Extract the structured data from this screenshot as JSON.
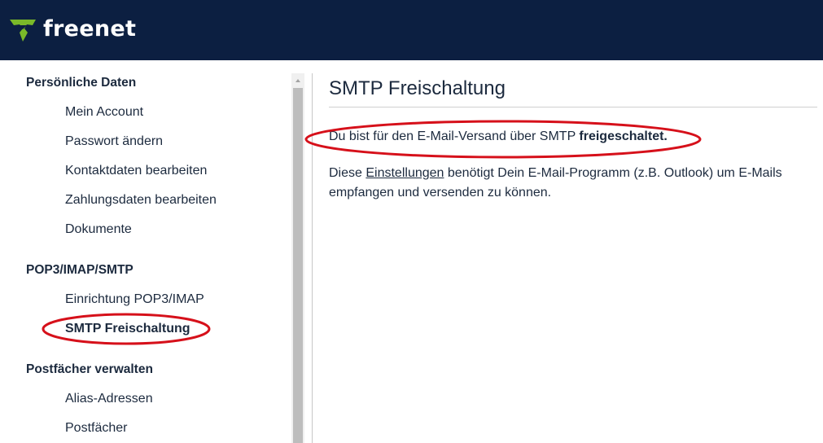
{
  "header": {
    "brand": "freenet",
    "brand_color": "#7ab929",
    "background": "#0c1f41",
    "logo_icon": "freenet-logo-icon"
  },
  "sidebar": {
    "sections": [
      {
        "title": "Persönliche Daten",
        "items": [
          {
            "label": "Mein Account"
          },
          {
            "label": "Passwort ändern"
          },
          {
            "label": "Kontaktdaten bearbeiten"
          },
          {
            "label": "Zahlungsdaten bearbeiten"
          },
          {
            "label": "Dokumente"
          }
        ]
      },
      {
        "title": "POP3/IMAP/SMTP",
        "items": [
          {
            "label": "Einrichtung POP3/IMAP"
          },
          {
            "label": "SMTP Freischaltung",
            "active": true
          }
        ]
      },
      {
        "title": "Postfächer verwalten",
        "items": [
          {
            "label": "Alias-Adressen"
          },
          {
            "label": "Postfächer"
          }
        ]
      }
    ]
  },
  "main": {
    "title": "SMTP Freischaltung",
    "status_prefix": "Du bist für den E-Mail-Versand über SMTP ",
    "status_bold": "freigeschaltet.",
    "info_prefix": "Diese ",
    "info_link": "Einstellungen",
    "info_suffix": " benötigt Dein E-Mail-Programm (z.B. Outlook) um E-Mails empfangen und versenden zu können."
  },
  "annotations": {
    "color": "#d6101a"
  }
}
